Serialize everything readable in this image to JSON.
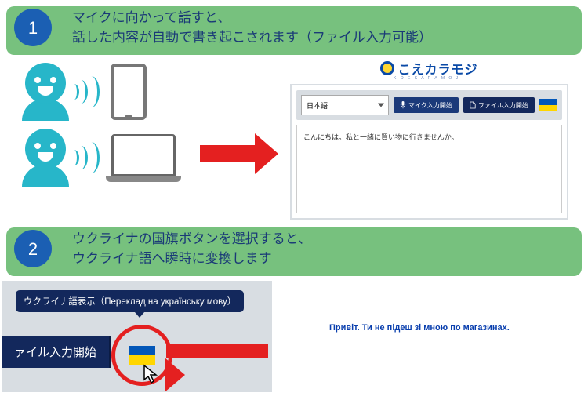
{
  "step1": {
    "num": "1",
    "text": "マイクに向かって話すと、\n話した内容が自動で書き起こされます（ファイル入力可能）"
  },
  "app": {
    "brand_main": "こえカラモジ",
    "brand_sub": "K O E K A R A M O J I",
    "select_value": "日本語",
    "mic_btn": "マイク入力開始",
    "file_btn": "ファイル入力開始",
    "flag_name": "ウクライナ",
    "transcript_text": "こんにちは。私と一緒に買い物に行きませんか。"
  },
  "step2": {
    "num": "2",
    "text": "ウクライナの国旗ボタンを選択すると、\nウクライナ語へ瞬時に変換します"
  },
  "closeup": {
    "tooltip": "ウクライナ語表示（Переклад на українську мову）",
    "file_btn_cropped": "ァイル入力開始"
  },
  "translated_text": "Привіт. Ти не підеш зі мною по магазинах."
}
